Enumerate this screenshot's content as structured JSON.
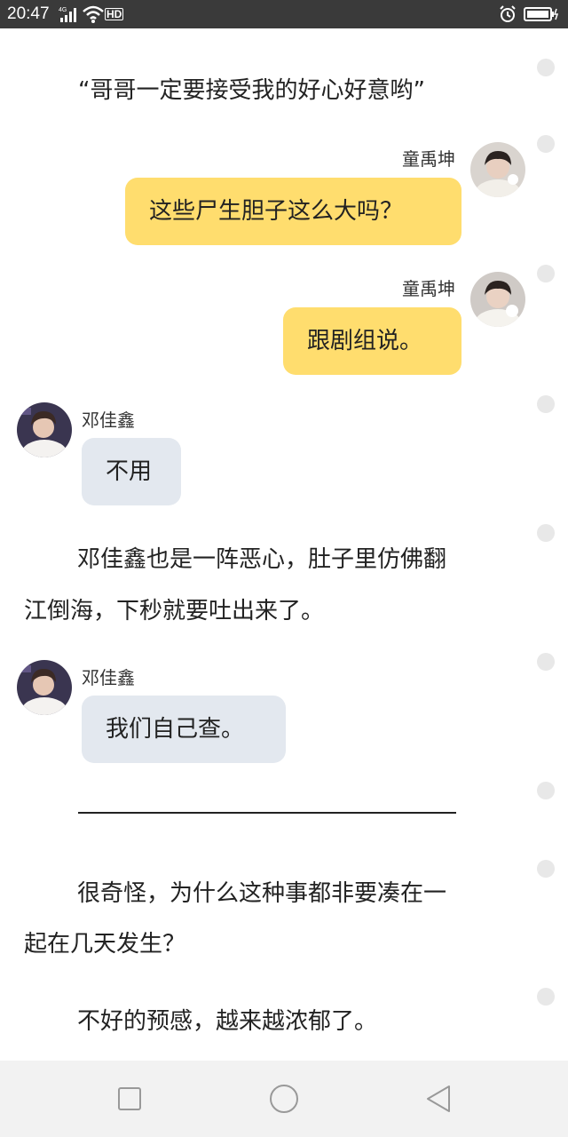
{
  "status_bar": {
    "time": "20:47",
    "network": "4G",
    "hd": "HD"
  },
  "content": {
    "quote": "“哥哥一定要接受我的好心好意哟”",
    "messages": [
      {
        "sender": "童禹坤",
        "text": "这些尸生胆子这么大吗？",
        "side": "right"
      },
      {
        "sender": "童禹坤",
        "text": "跟剧组说。",
        "side": "right"
      },
      {
        "sender": "邓佳鑫",
        "text": "不用",
        "side": "left"
      }
    ],
    "paragraph1_line1": "邓佳鑫也是一阵恶心，肚子里仿佛翻",
    "paragraph1_line2": "江倒海，下秒就要吐出来了。",
    "message4": {
      "sender": "邓佳鑫",
      "text": "我们自己查。",
      "side": "left"
    },
    "divider": "——————————————————",
    "paragraph2_line1": "很奇怪，为什么这种事都非要凑在一",
    "paragraph2_line2": "起在几天发生？",
    "paragraph3": "不好的预感，越来越浓郁了。"
  },
  "colors": {
    "right_bubble": "#ffdd6e",
    "left_bubble": "#e3e8ef",
    "status_bar": "#3a3a3a"
  },
  "navigation": {
    "buttons": [
      "recent-apps",
      "home",
      "back"
    ]
  }
}
